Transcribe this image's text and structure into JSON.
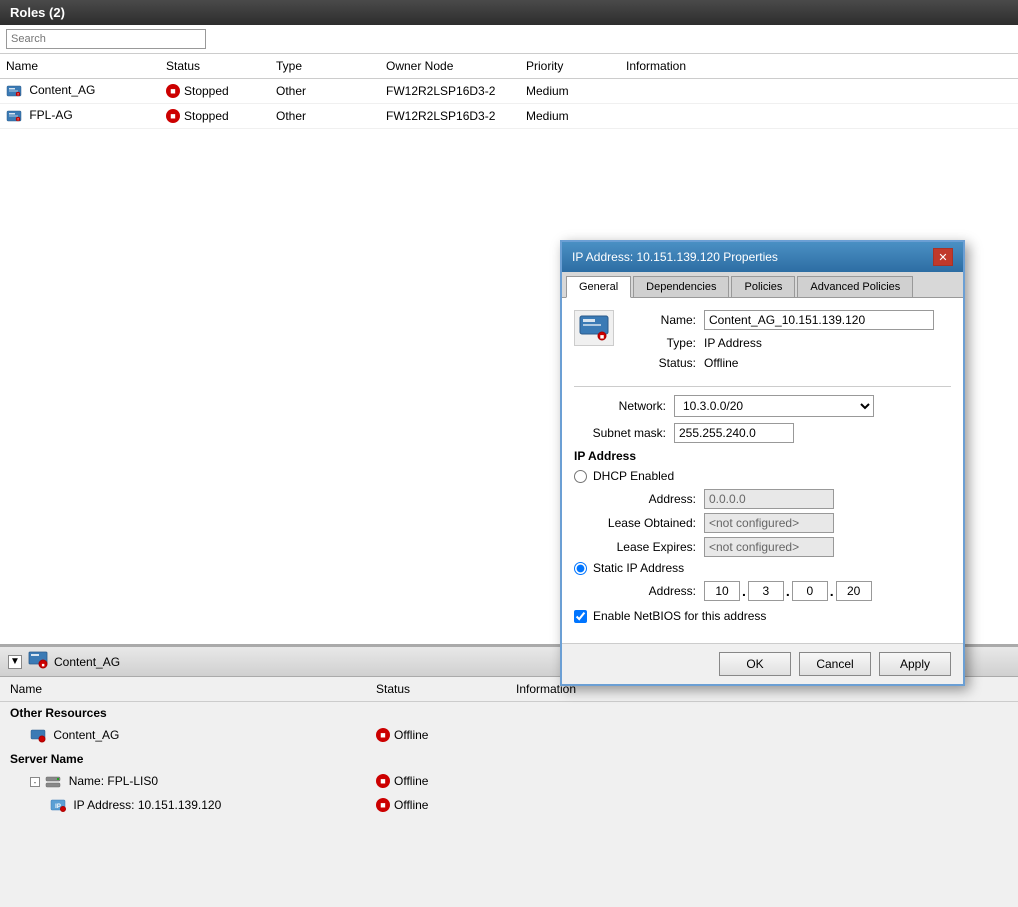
{
  "titleBar": {
    "label": "Roles (2)"
  },
  "search": {
    "placeholder": "Search"
  },
  "table": {
    "columns": [
      "Name",
      "Status",
      "Type",
      "Owner Node",
      "Priority",
      "Information"
    ],
    "rows": [
      {
        "name": "Content_AG",
        "status": "Stopped",
        "type": "Other",
        "ownerNode": "FW12R2LSP16D3-2",
        "priority": "Medium",
        "information": ""
      },
      {
        "name": "FPL-AG",
        "status": "Stopped",
        "type": "Other",
        "ownerNode": "FW12R2LSP16D3-2",
        "priority": "Medium",
        "information": ""
      }
    ]
  },
  "bottomPanel": {
    "title": "Content_AG",
    "expandBtn": "▼",
    "tableColumns": [
      "Name",
      "Status",
      "Information"
    ],
    "sections": [
      {
        "header": "Other Resources",
        "items": [
          {
            "name": "Content_AG",
            "status": "Offline",
            "indent": 1
          }
        ]
      },
      {
        "header": "Server Name",
        "items": [
          {
            "name": "Name: FPL-LIS0",
            "status": "Offline",
            "indent": 1
          },
          {
            "name": "IP Address: 10.151.139.120",
            "status": "Offline",
            "indent": 2
          }
        ]
      }
    ]
  },
  "dialog": {
    "title": "IP Address: 10.151.139.120 Properties",
    "closeBtn": "✕",
    "tabs": [
      "General",
      "Dependencies",
      "Policies",
      "Advanced Policies"
    ],
    "activeTab": "General",
    "fields": {
      "nameLabel": "Name:",
      "nameValue": "Content_AG_10.151.139.120",
      "typeLabel": "Type:",
      "typeValue": "IP Address",
      "statusLabel": "Status:",
      "statusValue": "Offline"
    },
    "networkLabel": "Network:",
    "networkValue": "10.3.0.0/20",
    "subnetLabel": "Subnet mask:",
    "subnetValue": "255.255.240.0",
    "ipAddressSection": "IP Address",
    "dhcpLabel": "DHCP Enabled",
    "dhcpRadio": false,
    "addressLabel": "Address:",
    "addressValue": "0.0.0.0",
    "leaseObtainedLabel": "Lease Obtained:",
    "leaseObtainedValue": "<not configured>",
    "leaseExpiresLabel": "Lease Expires:",
    "leaseExpiresValue": "<not configured>",
    "staticLabel": "Static IP Address",
    "staticRadio": true,
    "staticAddressLabel": "Address:",
    "staticOctet1": "10",
    "staticOctet2": "3",
    "staticOctet3": "0",
    "staticOctet4": "20",
    "checkboxLabel": "Enable NetBIOS for this address",
    "checkboxChecked": true,
    "buttons": {
      "ok": "OK",
      "cancel": "Cancel",
      "apply": "Apply"
    }
  }
}
